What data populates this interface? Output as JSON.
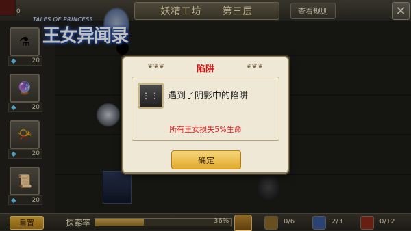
{
  "corner": {
    "count": "0"
  },
  "logo": {
    "subtitle": "TALES OF PRINCESS",
    "title": "王女异闻录"
  },
  "topbar": {
    "location": "妖精工坊",
    "floor": "第三层",
    "rules_label": "查看规则",
    "close_label": "✕"
  },
  "sidebar": {
    "items": [
      {
        "icon": "potion-icon",
        "glyph": "⚗",
        "price": "20"
      },
      {
        "icon": "orb-icon",
        "glyph": "🔮",
        "price": "20"
      },
      {
        "icon": "horn-icon",
        "glyph": "📯",
        "price": "20"
      },
      {
        "icon": "scroll-icon",
        "glyph": "📜",
        "price": "20"
      }
    ]
  },
  "dialog": {
    "title": "陷阱",
    "message": "遇到了阴影中的陷阱",
    "effect": "所有王女损失5%生命",
    "confirm_label": "确定",
    "icon_glyph": "⋮⋮"
  },
  "bottombar": {
    "reset_label": "重置",
    "explore_label": "探索率",
    "progress": 0.36,
    "progress_text": "36%",
    "stats": [
      {
        "icon": "chest-stat-icon",
        "value": "0/6"
      },
      {
        "icon": "fairy-stat-icon",
        "value": "2/3"
      },
      {
        "icon": "monster-stat-icon",
        "value": "0/12"
      }
    ]
  },
  "colors": {
    "title_red": "#d01818",
    "effect_red": "#e02020",
    "button_gold": "#e0a92a"
  }
}
